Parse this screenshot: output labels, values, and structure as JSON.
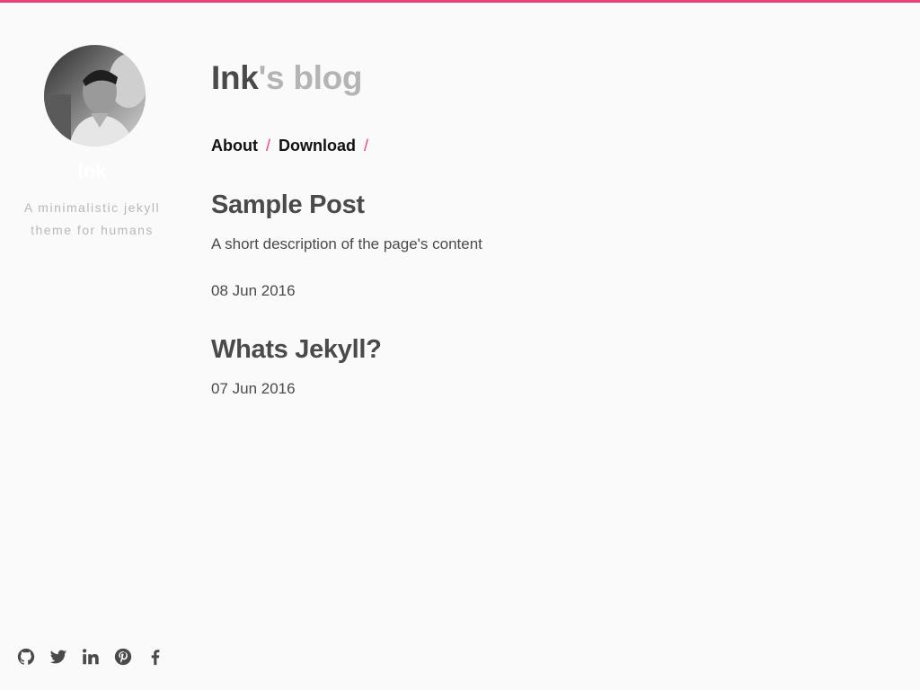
{
  "theme": {
    "accent": "#ee3f76",
    "text": "#4a4a4a",
    "muted": "#b4b4b4",
    "background": "#fafafa"
  },
  "sidebar": {
    "author_name": "Ink",
    "description": "A minimalistic jekyll theme for humans",
    "social_icons": [
      "github-icon",
      "twitter-icon",
      "linkedin-icon",
      "pinterest-icon",
      "facebook-icon"
    ]
  },
  "header": {
    "title_main": "Ink",
    "title_rest": "'s blog",
    "separator": "/"
  },
  "nav": {
    "items": [
      {
        "label": "About"
      },
      {
        "label": "Download"
      }
    ]
  },
  "posts": [
    {
      "title": "Sample Post",
      "description": "A short description of the page's content",
      "date": "08 Jun 2016"
    },
    {
      "title": "Whats Jekyll?",
      "date": "07 Jun 2016"
    }
  ]
}
